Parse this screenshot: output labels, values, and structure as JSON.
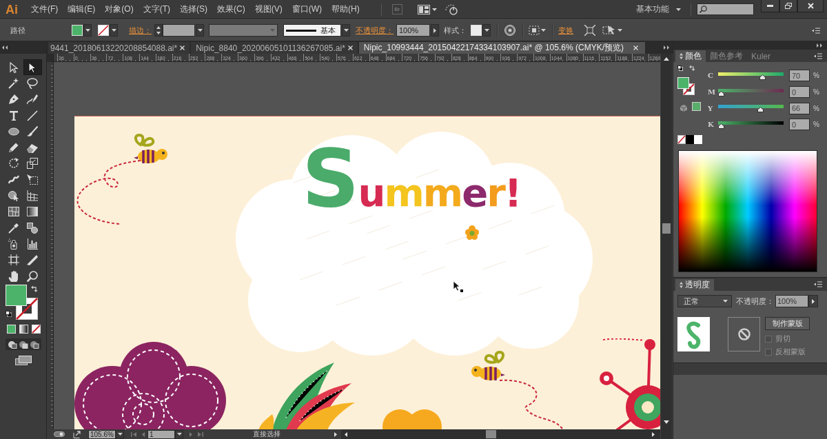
{
  "app_logo": "Ai",
  "menu": [
    "文件(F)",
    "编辑(E)",
    "对象(O)",
    "文字(T)",
    "选择(S)",
    "效果(C)",
    "视图(V)",
    "窗口(W)",
    "帮助(H)"
  ],
  "bridge_button": "Br",
  "workspace": "基本功能",
  "control_bar": {
    "selection_type": "路径",
    "stroke_link": "描边：",
    "stroke_profile": "基本",
    "opacity_link": "不透明度：",
    "opacity": "100%",
    "style_label": "样式：",
    "transform_link": "变换"
  },
  "document_tabs": [
    {
      "label": "9441_20180613220208854088.ai*",
      "selected": false
    },
    {
      "label": "Nipic_8840_20200605101136267085.ai*",
      "selected": false
    },
    {
      "label": "Nipic_10993444_20150422174334103907.ai* @ 105.6% (CMYK/预览)",
      "selected": true
    }
  ],
  "ruler_ticks": [
    "36",
    "0",
    "36",
    "72",
    "108",
    "144",
    "180",
    "216",
    "252",
    "288",
    "324",
    "360",
    "396",
    "432",
    "468",
    "504",
    "540",
    "576",
    "612",
    "648",
    "684",
    "720",
    "756",
    "792",
    "828",
    "864",
    "900",
    "936",
    "972",
    "1008",
    "1044",
    "1080",
    "1116",
    "1152",
    "1188",
    "1224",
    "1260"
  ],
  "toolbar": {
    "tools": [
      {
        "selected": false
      },
      {
        "selected": true
      },
      {
        "selected": false
      },
      {
        "selected": false
      },
      {
        "selected": false
      },
      {
        "selected": false
      },
      {
        "selected": false
      },
      {
        "selected": false
      },
      {
        "selected": false
      },
      {
        "selected": false
      },
      {
        "selected": false
      },
      {
        "selected": false
      },
      {
        "selected": false
      },
      {
        "selected": false
      },
      {
        "selected": false
      },
      {
        "selected": false
      },
      {
        "selected": false
      },
      {
        "selected": false
      },
      {
        "selected": false
      },
      {
        "selected": false
      },
      {
        "selected": false
      },
      {
        "selected": false
      },
      {
        "selected": false
      },
      {
        "selected": false
      },
      {
        "selected": false
      },
      {
        "selected": false
      },
      {
        "selected": false
      },
      {
        "selected": false
      }
    ]
  },
  "artboard": {
    "title": "Summer!"
  },
  "color_panel": {
    "tabs": [
      {
        "label": "颜色",
        "selected": true
      },
      {
        "label": "颜色参考",
        "selected": false
      },
      {
        "label": "Kuler",
        "selected": false
      }
    ],
    "channels": [
      {
        "name": "C",
        "level": 0.7,
        "value": "70",
        "unit": "%"
      },
      {
        "name": "M",
        "level": 0,
        "value": "0",
        "unit": "%"
      },
      {
        "name": "Y",
        "level": 0.66,
        "value": "66",
        "unit": "%"
      },
      {
        "name": "K",
        "level": 0,
        "value": "0",
        "unit": "%"
      }
    ]
  },
  "transparency_panel": {
    "tabs": [
      {
        "label": "透明度",
        "selected": true
      }
    ],
    "blend_mode": "正常",
    "opacity_label": "不透明度：",
    "opacity": "100%",
    "mask_button": "制作蒙版",
    "options": [
      {
        "label": "剪切",
        "checked": false,
        "disabled": true
      },
      {
        "label": "反相蒙版",
        "checked": false,
        "disabled": true
      }
    ]
  },
  "status_bar": {
    "zoom": "105.6%",
    "artboard_number": "1",
    "current_tool": "直接选择"
  }
}
